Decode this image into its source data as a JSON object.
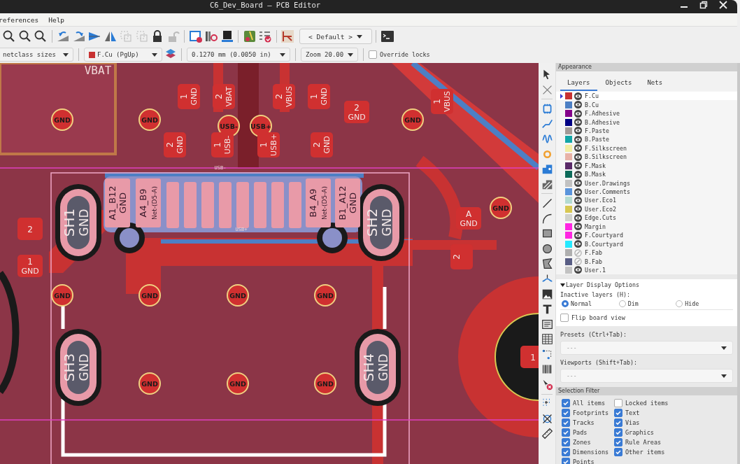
{
  "window": {
    "title": "C6_Dev_Board — PCB Editor"
  },
  "menu": [
    "references",
    "Help"
  ],
  "toolbar": {
    "preset": "< Default >"
  },
  "options_bar": {
    "track_width": "netclass sizes",
    "layer": "F.Cu (PgUp)",
    "grid": "0.1270 mm (0.0050 in)",
    "zoom": "Zoom 20.00",
    "override_locks": {
      "label": "Override locks",
      "checked": false
    }
  },
  "board": {
    "labels": [
      "VBAT",
      "USB-",
      "USB+"
    ],
    "vias": [
      {
        "net": "GND"
      },
      {
        "net": "GND"
      },
      {
        "net": "GND"
      },
      {
        "net": "GND"
      },
      {
        "net": "GND"
      },
      {
        "net": "GND"
      },
      {
        "net": "GND"
      },
      {
        "net": "GND"
      },
      {
        "net": "GND"
      },
      {
        "net": "GND"
      },
      {
        "net": "GND"
      },
      {
        "net": "USB-"
      },
      {
        "net": "USB+"
      }
    ],
    "pads": [
      {
        "pin": "1",
        "net": "GND"
      },
      {
        "pin": "2",
        "net": "VBAT"
      },
      {
        "pin": "2",
        "net": "VBUS"
      },
      {
        "pin": "1",
        "net": "GND"
      },
      {
        "pin": "2",
        "net": "GND"
      },
      {
        "pin": "2",
        "net": "GND"
      },
      {
        "pin": "1",
        "net": "USB-"
      },
      {
        "pin": "1",
        "net": "USB+"
      },
      {
        "pin": "2",
        "net": "GND"
      },
      {
        "pin": "1",
        "net": "VBUS"
      },
      {
        "pin": "2"
      },
      {
        "pin": "1",
        "net": "GND"
      },
      {
        "pin": "2"
      },
      {
        "pin": "A",
        "net": "GND"
      },
      {
        "pin": "1"
      }
    ],
    "connector_pins": [
      {
        "pin": "A1_B12",
        "net": "GND"
      },
      {
        "pin": "A4_B9",
        "net": "Net-(D5-A)"
      },
      {
        "pin": "B4_A9",
        "net": "Net-(D5-A)"
      },
      {
        "pin": "B1_A12",
        "net": "GND"
      }
    ],
    "shield_slots": [
      {
        "pin": "SH1",
        "net": "GND"
      },
      {
        "pin": "SH2",
        "net": "GND"
      },
      {
        "pin": "SH3",
        "net": "GND"
      },
      {
        "pin": "SH4",
        "net": "GND"
      }
    ]
  },
  "appearance": {
    "title": "Appearance",
    "tabs": [
      {
        "label": "Layers",
        "selected": true
      },
      {
        "label": "Objects",
        "selected": false
      },
      {
        "label": "Nets",
        "selected": false
      }
    ],
    "layers": [
      {
        "name": "F.Cu",
        "color": "#c83232",
        "visible": true,
        "selected": true
      },
      {
        "name": "B.Cu",
        "color": "#4d7fc4",
        "visible": true,
        "selected": false
      },
      {
        "name": "F.Adhesive",
        "color": "#84008a",
        "visible": true,
        "selected": false
      },
      {
        "name": "B.Adhesive",
        "color": "#000084",
        "visible": true,
        "selected": false
      },
      {
        "name": "F.Paste",
        "color": "#a39a97",
        "visible": true,
        "selected": false
      },
      {
        "name": "B.Paste",
        "color": "#12a6a6",
        "visible": true,
        "selected": false
      },
      {
        "name": "F.Silkscreen",
        "color": "#f2eda1",
        "visible": true,
        "selected": false
      },
      {
        "name": "B.Silkscreen",
        "color": "#e8b2a7",
        "visible": true,
        "selected": false
      },
      {
        "name": "F.Mask",
        "color": "#5a2a68",
        "visible": true,
        "selected": false
      },
      {
        "name": "B.Mask",
        "color": "#0d6b5a",
        "visible": true,
        "selected": false
      },
      {
        "name": "User.Drawings",
        "color": "#c2c2c2",
        "visible": true,
        "selected": false
      },
      {
        "name": "User.Comments",
        "color": "#5994dc",
        "visible": true,
        "selected": false
      },
      {
        "name": "User.Eco1",
        "color": "#b4dbd2",
        "visible": true,
        "selected": false
      },
      {
        "name": "User.Eco2",
        "color": "#d8c852",
        "visible": true,
        "selected": false
      },
      {
        "name": "Edge.Cuts",
        "color": "#d0d2cd",
        "visible": true,
        "selected": false
      },
      {
        "name": "Margin",
        "color": "#ff26e2",
        "visible": true,
        "selected": false
      },
      {
        "name": "F.Courtyard",
        "color": "#ff26e2",
        "visible": true,
        "selected": false
      },
      {
        "name": "B.Courtyard",
        "color": "#26e9ff",
        "visible": true,
        "selected": false
      },
      {
        "name": "F.Fab",
        "color": "#afafaf",
        "visible": false,
        "selected": false
      },
      {
        "name": "B.Fab",
        "color": "#585d84",
        "visible": false,
        "selected": false
      },
      {
        "name": "User.1",
        "color": "#c2c2c2",
        "visible": true,
        "selected": false
      }
    ],
    "display_options": {
      "title": "Layer Display Options",
      "expanded": true,
      "inactive_label": "Inactive layers (H):",
      "modes": [
        {
          "label": "Normal",
          "selected": true
        },
        {
          "label": "Dim",
          "selected": false
        },
        {
          "label": "Hide",
          "selected": false
        }
      ],
      "flip": {
        "label": "Flip board view",
        "checked": false
      }
    },
    "presets": {
      "label": "Presets (Ctrl+Tab):",
      "value": "---"
    },
    "viewports": {
      "label": "Viewports (Shift+Tab):",
      "value": "---"
    }
  },
  "selection_filter": {
    "title": "Selection Filter",
    "items": [
      {
        "label": "All items",
        "checked": true
      },
      {
        "label": "Locked items",
        "checked": false
      },
      {
        "label": "Footprints",
        "checked": true
      },
      {
        "label": "Text",
        "checked": true
      },
      {
        "label": "Tracks",
        "checked": true
      },
      {
        "label": "Vias",
        "checked": true
      },
      {
        "label": "Pads",
        "checked": true
      },
      {
        "label": "Graphics",
        "checked": true
      },
      {
        "label": "Zones",
        "checked": true
      },
      {
        "label": "Rule Areas",
        "checked": true
      },
      {
        "label": "Dimensions",
        "checked": true
      },
      {
        "label": "Other items",
        "checked": true
      },
      {
        "label": "Points",
        "checked": true
      }
    ]
  }
}
